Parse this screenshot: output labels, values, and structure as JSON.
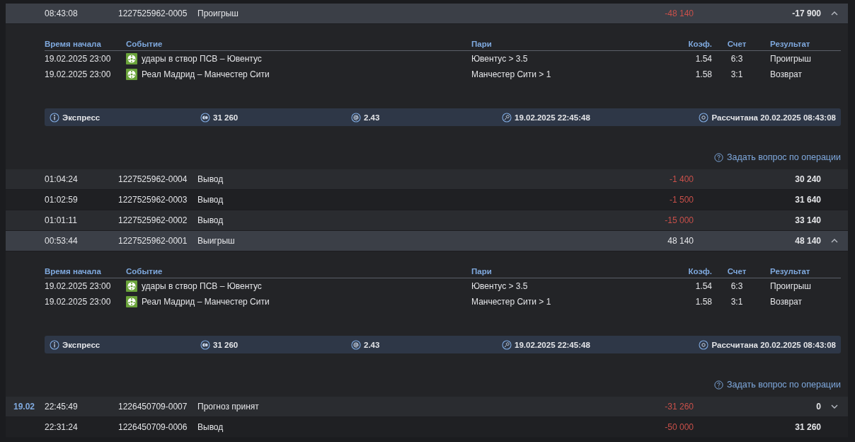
{
  "operations": [
    {
      "time": "08:43:08",
      "id": "1227525962-0005",
      "type": "Проигрыш",
      "amount": "-48 140",
      "color": "#c9504a",
      "balance": "-17 900",
      "expanded": true,
      "details": {
        "columns": [
          "Время начала",
          "Событие",
          "Пари",
          "Коэф.",
          "Счет",
          "Результат"
        ],
        "bets": [
          {
            "start": "19.02.2025 23:00",
            "event": "удары в створ ПСВ – Ювентус",
            "pick": "Ювентус > 3.5",
            "odds": "1.54",
            "score": "6:3",
            "result": "Проигрыш"
          },
          {
            "start": "19.02.2025 23:00",
            "event": "Реал Мадрид – Манчестер Сити",
            "pick": "Манчестер Сити > 1",
            "odds": "1.58",
            "score": "3:1",
            "result": "Возврат"
          }
        ],
        "summary": {
          "bet_type": "Экспресс",
          "stake": "31 260",
          "total_odds": "2.43",
          "placed": "19.02.2025 22:45:48",
          "settled": "Рассчитана 20.02.2025 08:43:08"
        },
        "ask_link": "Задать вопрос по операции"
      }
    },
    {
      "time": "01:04:24",
      "id": "1227525962-0004",
      "type": "Вывод",
      "amount": "-1 400",
      "color": "#c9504a",
      "balance": "30 240"
    },
    {
      "time": "01:02:59",
      "id": "1227525962-0003",
      "type": "Вывод",
      "amount": "-1 500",
      "color": "#c9504a",
      "balance": "31 640"
    },
    {
      "time": "01:01:11",
      "id": "1227525962-0002",
      "type": "Вывод",
      "amount": "-15 000",
      "color": "#c9504a",
      "balance": "33 140"
    },
    {
      "time": "00:53:44",
      "id": "1227525962-0001",
      "type": "Выигрыш",
      "amount": "48 140",
      "color": "#e4e5e8",
      "balance": "48 140",
      "expanded": true,
      "details": {
        "columns": [
          "Время начала",
          "Событие",
          "Пари",
          "Коэф.",
          "Счет",
          "Результат"
        ],
        "bets": [
          {
            "start": "19.02.2025 23:00",
            "event": "удары в створ ПСВ – Ювентус",
            "pick": "Ювентус > 3.5",
            "odds": "1.54",
            "score": "6:3",
            "result": "Проигрыш"
          },
          {
            "start": "19.02.2025 23:00",
            "event": "Реал Мадрид – Манчестер Сити",
            "pick": "Манчестер Сити > 1",
            "odds": "1.58",
            "score": "3:1",
            "result": "Возврат"
          }
        ],
        "summary": {
          "bet_type": "Экспресс",
          "stake": "31 260",
          "total_odds": "2.43",
          "placed": "19.02.2025 22:45:48",
          "settled": "Рассчитана 20.02.2025 08:43:08"
        },
        "ask_link": "Задать вопрос по операции"
      }
    },
    {
      "date": "19.02",
      "time": "22:45:49",
      "id": "1226450709-0007",
      "type": "Прогноз принят",
      "amount": "-31 260",
      "color": "#c9504a",
      "balance": "0",
      "expanded": false
    },
    {
      "time": "22:31:24",
      "id": "1226450709-0006",
      "type": "Вывод",
      "amount": "-50 000",
      "color": "#c9504a",
      "balance": "31 260"
    }
  ]
}
